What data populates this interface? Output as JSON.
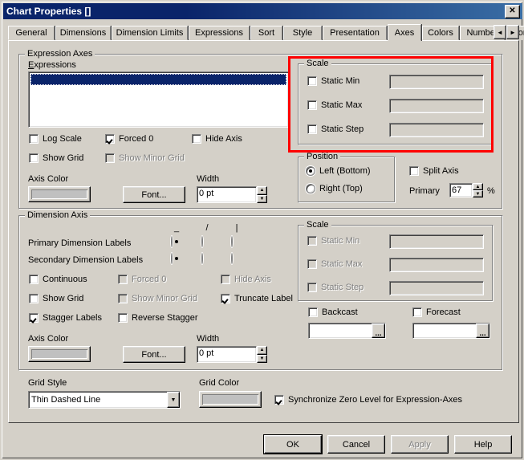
{
  "window": {
    "title": "Chart Properties []",
    "close_label": "✕",
    "titlebar_color": "#0a246a",
    "face_color": "#d4d0c8",
    "highlight_color": "#ff0000"
  },
  "tabs": {
    "items": [
      {
        "label": "General",
        "active": false
      },
      {
        "label": "Dimensions",
        "active": false
      },
      {
        "label": "Dimension Limits",
        "active": false
      },
      {
        "label": "Expressions",
        "active": false
      },
      {
        "label": "Sort",
        "active": false
      },
      {
        "label": "Style",
        "active": false
      },
      {
        "label": "Presentation",
        "active": false
      },
      {
        "label": "Axes",
        "active": true
      },
      {
        "label": "Colors",
        "active": false
      },
      {
        "label": "Number",
        "active": false
      },
      {
        "label": "Font",
        "active": false
      }
    ],
    "scroll_prev": "◄",
    "scroll_next": "►"
  },
  "expression_axes": {
    "group_label": "Expression Axes",
    "expressions_label": "Expressions",
    "selected_item": "",
    "log_scale": {
      "label": "Log Scale",
      "checked": false,
      "enabled": true
    },
    "forced_0": {
      "label": "Forced 0",
      "checked": true,
      "enabled": true
    },
    "hide_axis": {
      "label": "Hide Axis",
      "checked": false,
      "enabled": true
    },
    "show_grid": {
      "label": "Show Grid",
      "checked": false,
      "enabled": true
    },
    "show_minor_grid": {
      "label": "Show Minor Grid",
      "checked": false,
      "enabled": false
    },
    "axis_color_label": "Axis Color",
    "axis_color_value": "#c0c0c0",
    "font_button": "Font...",
    "width_label": "Width",
    "width_value": "0 pt",
    "scale": {
      "group_label": "Scale",
      "static_min": {
        "label": "Static Min",
        "checked": false,
        "value": "",
        "enabled": true
      },
      "static_max": {
        "label": "Static Max",
        "checked": false,
        "value": "",
        "enabled": true
      },
      "static_step": {
        "label": "Static Step",
        "checked": false,
        "value": "",
        "enabled": true
      }
    },
    "position": {
      "group_label": "Position",
      "left_bottom": {
        "label": "Left (Bottom)",
        "selected": true
      },
      "right_top": {
        "label": "Right (Top)",
        "selected": false
      }
    },
    "split_axis": {
      "label": "Split Axis",
      "checked": false
    },
    "primary_label": "Primary",
    "primary_value": "67",
    "percent_symbol": "%"
  },
  "dimension_axis": {
    "group_label": "Dimension Axis",
    "column_headers": [
      "_",
      "/",
      "|"
    ],
    "primary_labels_row": {
      "label": "Primary Dimension Labels",
      "selected_index": 0
    },
    "secondary_labels_row": {
      "label": "Secondary Dimension Labels",
      "selected_index": 0
    },
    "continuous": {
      "label": "Continuous",
      "checked": false,
      "enabled": true
    },
    "forced_0": {
      "label": "Forced 0",
      "checked": false,
      "enabled": false
    },
    "hide_axis": {
      "label": "Hide Axis",
      "checked": false,
      "enabled": false
    },
    "show_grid": {
      "label": "Show Grid",
      "checked": false,
      "enabled": true
    },
    "show_minor_grid": {
      "label": "Show Minor Grid",
      "checked": false,
      "enabled": false
    },
    "truncate_label": {
      "label": "Truncate Label",
      "checked": true,
      "enabled": true
    },
    "stagger_labels": {
      "label": "Stagger Labels",
      "checked": true,
      "enabled": true
    },
    "reverse_stagger": {
      "label": "Reverse Stagger",
      "checked": false,
      "enabled": true
    },
    "axis_color_label": "Axis Color",
    "axis_color_value": "#c0c0c0",
    "font_button": "Font...",
    "width_label": "Width",
    "width_value": "0 pt",
    "scale": {
      "group_label": "Scale",
      "static_min": {
        "label": "Static Min",
        "checked": false,
        "value": "",
        "enabled": false
      },
      "static_max": {
        "label": "Static Max",
        "checked": false,
        "value": "",
        "enabled": false
      },
      "static_step": {
        "label": "Static Step",
        "checked": false,
        "value": "",
        "enabled": false
      }
    },
    "backcast": {
      "label": "Backcast",
      "checked": false,
      "value": "",
      "browse": "..."
    },
    "forecast": {
      "label": "Forecast",
      "checked": false,
      "value": "",
      "browse": "..."
    }
  },
  "bottom": {
    "grid_style_label": "Grid Style",
    "grid_style_value": "Thin Dashed Line",
    "grid_color_label": "Grid Color",
    "grid_color_value": "#c0c0c0",
    "sync_zero": {
      "label": "Synchronize Zero Level for Expression-Axes",
      "checked": true
    }
  },
  "buttons": {
    "ok": "OK",
    "cancel": "Cancel",
    "apply": "Apply",
    "help": "Help"
  }
}
